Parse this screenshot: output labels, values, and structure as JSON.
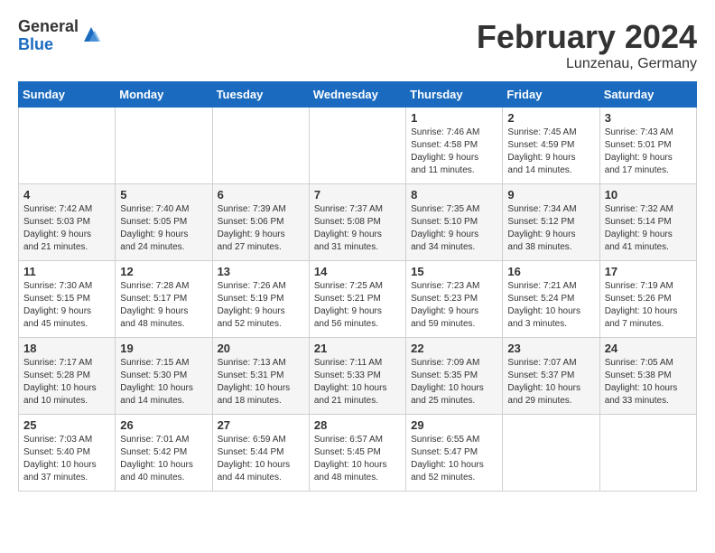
{
  "logo": {
    "general": "General",
    "blue": "Blue"
  },
  "title": "February 2024",
  "location": "Lunzenau, Germany",
  "days_of_week": [
    "Sunday",
    "Monday",
    "Tuesday",
    "Wednesday",
    "Thursday",
    "Friday",
    "Saturday"
  ],
  "weeks": [
    [
      {
        "day": "",
        "info": ""
      },
      {
        "day": "",
        "info": ""
      },
      {
        "day": "",
        "info": ""
      },
      {
        "day": "",
        "info": ""
      },
      {
        "day": "1",
        "info": "Sunrise: 7:46 AM\nSunset: 4:58 PM\nDaylight: 9 hours\nand 11 minutes."
      },
      {
        "day": "2",
        "info": "Sunrise: 7:45 AM\nSunset: 4:59 PM\nDaylight: 9 hours\nand 14 minutes."
      },
      {
        "day": "3",
        "info": "Sunrise: 7:43 AM\nSunset: 5:01 PM\nDaylight: 9 hours\nand 17 minutes."
      }
    ],
    [
      {
        "day": "4",
        "info": "Sunrise: 7:42 AM\nSunset: 5:03 PM\nDaylight: 9 hours\nand 21 minutes."
      },
      {
        "day": "5",
        "info": "Sunrise: 7:40 AM\nSunset: 5:05 PM\nDaylight: 9 hours\nand 24 minutes."
      },
      {
        "day": "6",
        "info": "Sunrise: 7:39 AM\nSunset: 5:06 PM\nDaylight: 9 hours\nand 27 minutes."
      },
      {
        "day": "7",
        "info": "Sunrise: 7:37 AM\nSunset: 5:08 PM\nDaylight: 9 hours\nand 31 minutes."
      },
      {
        "day": "8",
        "info": "Sunrise: 7:35 AM\nSunset: 5:10 PM\nDaylight: 9 hours\nand 34 minutes."
      },
      {
        "day": "9",
        "info": "Sunrise: 7:34 AM\nSunset: 5:12 PM\nDaylight: 9 hours\nand 38 minutes."
      },
      {
        "day": "10",
        "info": "Sunrise: 7:32 AM\nSunset: 5:14 PM\nDaylight: 9 hours\nand 41 minutes."
      }
    ],
    [
      {
        "day": "11",
        "info": "Sunrise: 7:30 AM\nSunset: 5:15 PM\nDaylight: 9 hours\nand 45 minutes."
      },
      {
        "day": "12",
        "info": "Sunrise: 7:28 AM\nSunset: 5:17 PM\nDaylight: 9 hours\nand 48 minutes."
      },
      {
        "day": "13",
        "info": "Sunrise: 7:26 AM\nSunset: 5:19 PM\nDaylight: 9 hours\nand 52 minutes."
      },
      {
        "day": "14",
        "info": "Sunrise: 7:25 AM\nSunset: 5:21 PM\nDaylight: 9 hours\nand 56 minutes."
      },
      {
        "day": "15",
        "info": "Sunrise: 7:23 AM\nSunset: 5:23 PM\nDaylight: 9 hours\nand 59 minutes."
      },
      {
        "day": "16",
        "info": "Sunrise: 7:21 AM\nSunset: 5:24 PM\nDaylight: 10 hours\nand 3 minutes."
      },
      {
        "day": "17",
        "info": "Sunrise: 7:19 AM\nSunset: 5:26 PM\nDaylight: 10 hours\nand 7 minutes."
      }
    ],
    [
      {
        "day": "18",
        "info": "Sunrise: 7:17 AM\nSunset: 5:28 PM\nDaylight: 10 hours\nand 10 minutes."
      },
      {
        "day": "19",
        "info": "Sunrise: 7:15 AM\nSunset: 5:30 PM\nDaylight: 10 hours\nand 14 minutes."
      },
      {
        "day": "20",
        "info": "Sunrise: 7:13 AM\nSunset: 5:31 PM\nDaylight: 10 hours\nand 18 minutes."
      },
      {
        "day": "21",
        "info": "Sunrise: 7:11 AM\nSunset: 5:33 PM\nDaylight: 10 hours\nand 21 minutes."
      },
      {
        "day": "22",
        "info": "Sunrise: 7:09 AM\nSunset: 5:35 PM\nDaylight: 10 hours\nand 25 minutes."
      },
      {
        "day": "23",
        "info": "Sunrise: 7:07 AM\nSunset: 5:37 PM\nDaylight: 10 hours\nand 29 minutes."
      },
      {
        "day": "24",
        "info": "Sunrise: 7:05 AM\nSunset: 5:38 PM\nDaylight: 10 hours\nand 33 minutes."
      }
    ],
    [
      {
        "day": "25",
        "info": "Sunrise: 7:03 AM\nSunset: 5:40 PM\nDaylight: 10 hours\nand 37 minutes."
      },
      {
        "day": "26",
        "info": "Sunrise: 7:01 AM\nSunset: 5:42 PM\nDaylight: 10 hours\nand 40 minutes."
      },
      {
        "day": "27",
        "info": "Sunrise: 6:59 AM\nSunset: 5:44 PM\nDaylight: 10 hours\nand 44 minutes."
      },
      {
        "day": "28",
        "info": "Sunrise: 6:57 AM\nSunset: 5:45 PM\nDaylight: 10 hours\nand 48 minutes."
      },
      {
        "day": "29",
        "info": "Sunrise: 6:55 AM\nSunset: 5:47 PM\nDaylight: 10 hours\nand 52 minutes."
      },
      {
        "day": "",
        "info": ""
      },
      {
        "day": "",
        "info": ""
      }
    ]
  ]
}
